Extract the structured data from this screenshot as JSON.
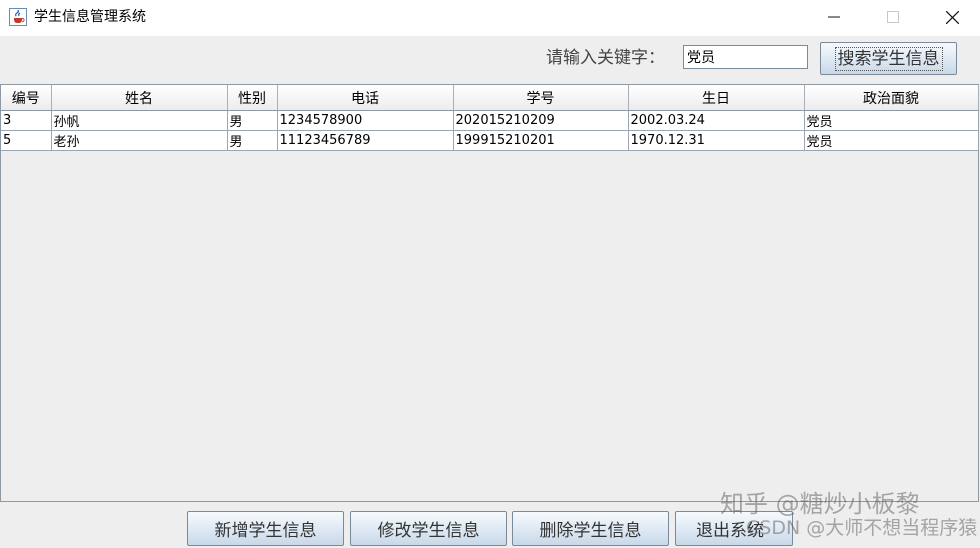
{
  "window": {
    "title": "学生信息管理系统",
    "app_icon": "java-coffee-icon",
    "controls": [
      "minimize-icon",
      "maximize-icon",
      "close-icon"
    ]
  },
  "search": {
    "label": "请输入关键字：",
    "value": "党员",
    "button_label": "搜索学生信息"
  },
  "table": {
    "columns": [
      "编号",
      "姓名",
      "性别",
      "电话",
      "学号",
      "生日",
      "政治面貌"
    ],
    "rows": [
      [
        "3",
        "孙帆",
        "男",
        "1234578900",
        "202015210209",
        "2002.03.24",
        "党员"
      ],
      [
        "5",
        "老孙",
        "男",
        "11123456789",
        "199915210201",
        "1970.12.31",
        "党员"
      ]
    ]
  },
  "actions": {
    "add_label": "新增学生信息",
    "edit_label": "修改学生信息",
    "delete_label": "删除学生信息",
    "exit_label": "退出系统"
  },
  "watermark": {
    "line1": "知乎 @糖炒小板黎",
    "line2": "CSDN @大师不想当程序猿"
  },
  "colors": {
    "title_bar": "#ffffff",
    "panel": "#eeeeee",
    "button_gradient_top": "#f7fafd",
    "button_gradient_bottom": "#c9d8e8",
    "button_border": "#7a8a99"
  }
}
